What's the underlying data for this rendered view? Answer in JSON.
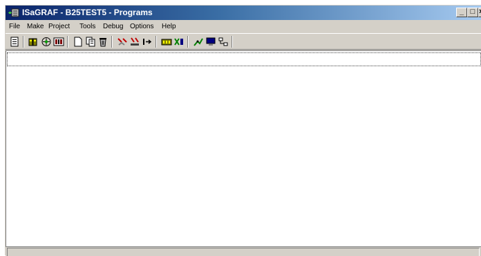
{
  "window": {
    "title": "ISaGRAF - B25TEST5 - Programs",
    "controls": {
      "minimize": "_",
      "maximize": "□",
      "close": "×"
    }
  },
  "menu": [
    "File",
    "Make",
    "Project",
    "Tools",
    "Debug",
    "Options",
    "Help"
  ],
  "toolbar": {
    "groups": [
      [
        "properties-icon"
      ],
      [
        "make-icon",
        "verify-icon",
        "dictionary-icon"
      ],
      [
        "new-program-icon",
        "copy-program-icon",
        "delete-program-icon"
      ],
      [
        "disconnect-icon",
        "download-icon",
        "run-icon"
      ],
      [
        "io-connection-icon",
        "variables-icon"
      ],
      [
        "debug-icon",
        "monitor-icon",
        "network-icon"
      ]
    ]
  },
  "status": {
    "text": ""
  },
  "colors": {
    "title_start": "#0a246a",
    "title_end": "#a6caf0",
    "face": "#d4d0c8"
  }
}
